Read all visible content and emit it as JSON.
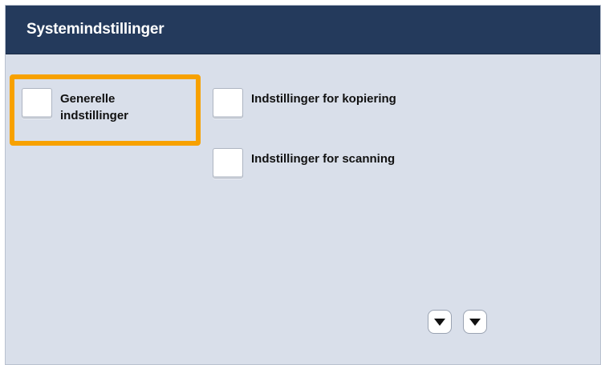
{
  "header": {
    "title": "Systemindstillinger"
  },
  "options": [
    {
      "label": "Generelle indstillinger",
      "selected": true
    },
    {
      "label": "Indstillinger for kopiering",
      "selected": false
    },
    {
      "label": "Indstillinger for scanning",
      "selected": false
    }
  ],
  "scroll_buttons": [
    {
      "icon": "arrow-down-icon"
    },
    {
      "icon": "arrow-down-icon"
    }
  ],
  "colors": {
    "header_bg": "#243a5c",
    "panel_bg": "#d9dfea",
    "selection_accent": "#f7a100"
  }
}
